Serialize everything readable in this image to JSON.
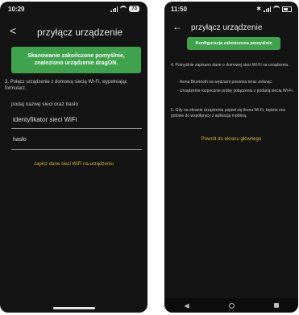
{
  "left": {
    "status": {
      "time": "10:29",
      "battery": "73"
    },
    "header": {
      "back": "<",
      "title": "przyłącz urządzenie"
    },
    "banner": "Skanowanie zakończone pomyślnie, znaleziono urządzenie dragON.",
    "instruction": "3. Połącz urządzenie z domową siecią Wi-Fi, wypełniając formularz.",
    "prompt": "podaj nazwę sieci oraz hasło",
    "ssid_placeholder": "identyfikator sieci WiFi",
    "password_placeholder": "hasło",
    "save_link": "zapisz dane sieci WiFi na urządzeniu"
  },
  "right": {
    "status": {
      "time": "11:50"
    },
    "header": {
      "back": "←",
      "title": "przyłącz urządzenie"
    },
    "banner": "Konfiguracja zakończona pomyślnie",
    "step4": "4. Pomyślnie zapisano dane o domowej sieci Wi-Fi na urządzeniu.",
    "bullet1": "- Ikona Bluetooth na wędzarni powinna teraz zniknąć.",
    "bullet2": "- Urządzenie rozpocznie próbę połączenia z podaną siecią Wi-Fi.",
    "step5": "5. Gdy na ekranie urządzenia pojawi się ikona Wi-Fi, będzie ono gotowe do współpracy z aplikacją mobilną.",
    "home_link": "Powrót do ekranu głównego",
    "nav": {
      "back": "◀",
      "home": "",
      "recents": ""
    }
  },
  "colors": {
    "background": "#141414",
    "banner": "#3fa34d",
    "link": "#d8b531"
  }
}
